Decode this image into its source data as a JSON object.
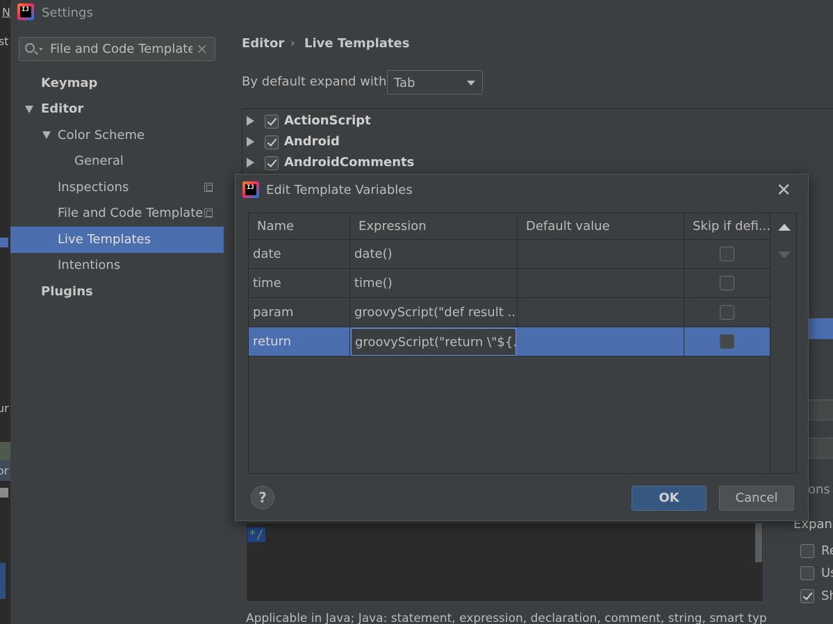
{
  "window": {
    "title": "Settings"
  },
  "background_fragments": [
    "N",
    "est",
    "ur",
    "or"
  ],
  "sidebar": {
    "search_value": "File and Code Template",
    "items": [
      {
        "label": "Keymap"
      },
      {
        "label": "Editor"
      },
      {
        "label": "Color Scheme"
      },
      {
        "label": "General"
      },
      {
        "label": "Inspections"
      },
      {
        "label": "File and Code Template"
      },
      {
        "label": "Live Templates"
      },
      {
        "label": "Intentions"
      },
      {
        "label": "Plugins"
      }
    ]
  },
  "breadcrumb": {
    "parent": "Editor",
    "current": "Live Templates"
  },
  "expand": {
    "label": "By default expand with",
    "value": "Tab"
  },
  "template_groups": [
    {
      "label": "ActionScript",
      "checked": true
    },
    {
      "label": "Android",
      "checked": true
    },
    {
      "label": "AndroidComments",
      "checked": true
    }
  ],
  "options_fragments": {
    "ons": "ons",
    "expand": "Expand",
    "opt1": "Re",
    "opt2": "Us",
    "opt3": "Sh"
  },
  "editor": {
    "code": "*/"
  },
  "applicable_text": "Applicable in Java; Java: statement, expression, declaration, comment, string, smart typ",
  "dialog": {
    "title": "Edit Template Variables",
    "columns": [
      "Name",
      "Expression",
      "Default value",
      "Skip if defi..."
    ],
    "rows": [
      {
        "name": "date",
        "expression": "date()",
        "default": "",
        "skip": false
      },
      {
        "name": "time",
        "expression": "time()",
        "default": "",
        "skip": false
      },
      {
        "name": "param",
        "expression": "groovyScript(\"def result ...",
        "default": "",
        "skip": false
      },
      {
        "name": "return",
        "expression": "groovyScript(\"return \\\"${...",
        "default": "",
        "skip": false
      }
    ],
    "help_label": "?",
    "ok_label": "OK",
    "cancel_label": "Cancel"
  },
  "colors": {
    "background": "#3c3f41",
    "selection": "#4b6eaf",
    "ok_button": "#365880",
    "editor_bg": "#2b2b2b"
  }
}
